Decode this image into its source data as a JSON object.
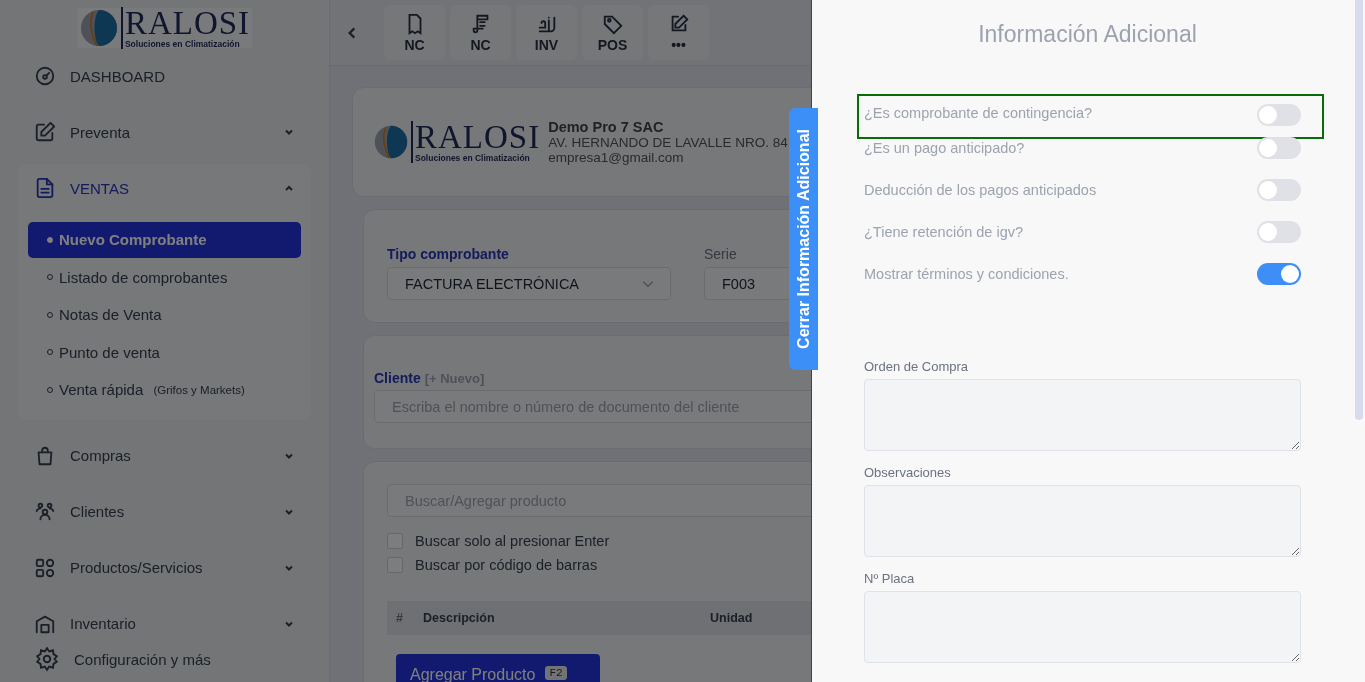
{
  "sidebar": {
    "logo": {
      "name": "RALOSI",
      "tagline": "Soluciones en Climatización"
    },
    "items": [
      {
        "kind": "link",
        "label": "DASHBOARD",
        "selected": false
      },
      {
        "kind": "group",
        "label": "Preventa",
        "selected": false,
        "expanded": false
      },
      {
        "kind": "group",
        "label": "VENTAS",
        "selected": true,
        "expanded": true,
        "children": [
          {
            "label": "Nuevo Comprobante",
            "selected": true
          },
          {
            "label": "Listado de comprobantes",
            "selected": false
          },
          {
            "label": "Notas de Venta",
            "selected": false
          },
          {
            "label": "Punto de venta",
            "selected": false
          },
          {
            "label": "Venta rápida",
            "note": "(Grifos y Markets)",
            "selected": false
          }
        ]
      },
      {
        "kind": "group",
        "label": "Compras",
        "selected": false,
        "expanded": false
      },
      {
        "kind": "group",
        "label": "Clientes",
        "selected": false,
        "expanded": false
      },
      {
        "kind": "group",
        "label": "Productos/Servicios",
        "selected": false,
        "expanded": false
      },
      {
        "kind": "group",
        "label": "Inventario",
        "selected": false,
        "expanded": false
      }
    ],
    "footer": "Configuración y más"
  },
  "toolbar": {
    "buttons": [
      {
        "label": "NC"
      },
      {
        "label": "NC"
      },
      {
        "label": "INV"
      },
      {
        "label": "POS"
      },
      {
        "label": "•••"
      }
    ]
  },
  "company": {
    "logo": {
      "name": "RALOSI",
      "tagline": "Soluciones en Climatización"
    },
    "name": "Demo Pro 7 SAC",
    "address": "AV. HERNANDO DE LAVALLE NRO. 84",
    "email": "empresa1@gmail.com"
  },
  "document": {
    "type_label": "Tipo comprobante",
    "type_value": "FACTURA ELECTRÓNICA",
    "series_label": "Serie",
    "series_value": "F003"
  },
  "client": {
    "label": "Cliente",
    "link": "[+ Nuevo]",
    "placeholder": "Escriba el nombre o número de documento del cliente"
  },
  "products": {
    "search_placeholder": "Buscar/Agregar producto",
    "options": [
      {
        "label": "Buscar solo al presionar Enter",
        "checked": false
      },
      {
        "label": "Buscar por código de barras",
        "checked": false
      }
    ],
    "table": {
      "columns": [
        "#",
        "Descripción",
        "Unidad"
      ]
    },
    "add_button": {
      "label": "Agregar Producto",
      "shortcut": "F2"
    }
  },
  "drawer_tab": {
    "label": "Cerrar Información Adicional"
  },
  "drawer": {
    "title": "Información Adicional",
    "options": [
      {
        "label": "¿Es comprobante de contingencia?",
        "on": false,
        "focused": true
      },
      {
        "label": "¿Es un pago anticipado?",
        "on": false,
        "focused": false
      },
      {
        "label": "Deducción de los pagos anticipados",
        "on": false,
        "focused": false
      },
      {
        "label": "¿Tiene retención de igv?",
        "on": false,
        "focused": false
      },
      {
        "label": "Mostrar términos y condiciones.",
        "on": true,
        "focused": false
      }
    ],
    "fields": [
      {
        "label": "Orden de Compra"
      },
      {
        "label": "Observaciones"
      },
      {
        "label": "Nº Placa"
      }
    ]
  }
}
